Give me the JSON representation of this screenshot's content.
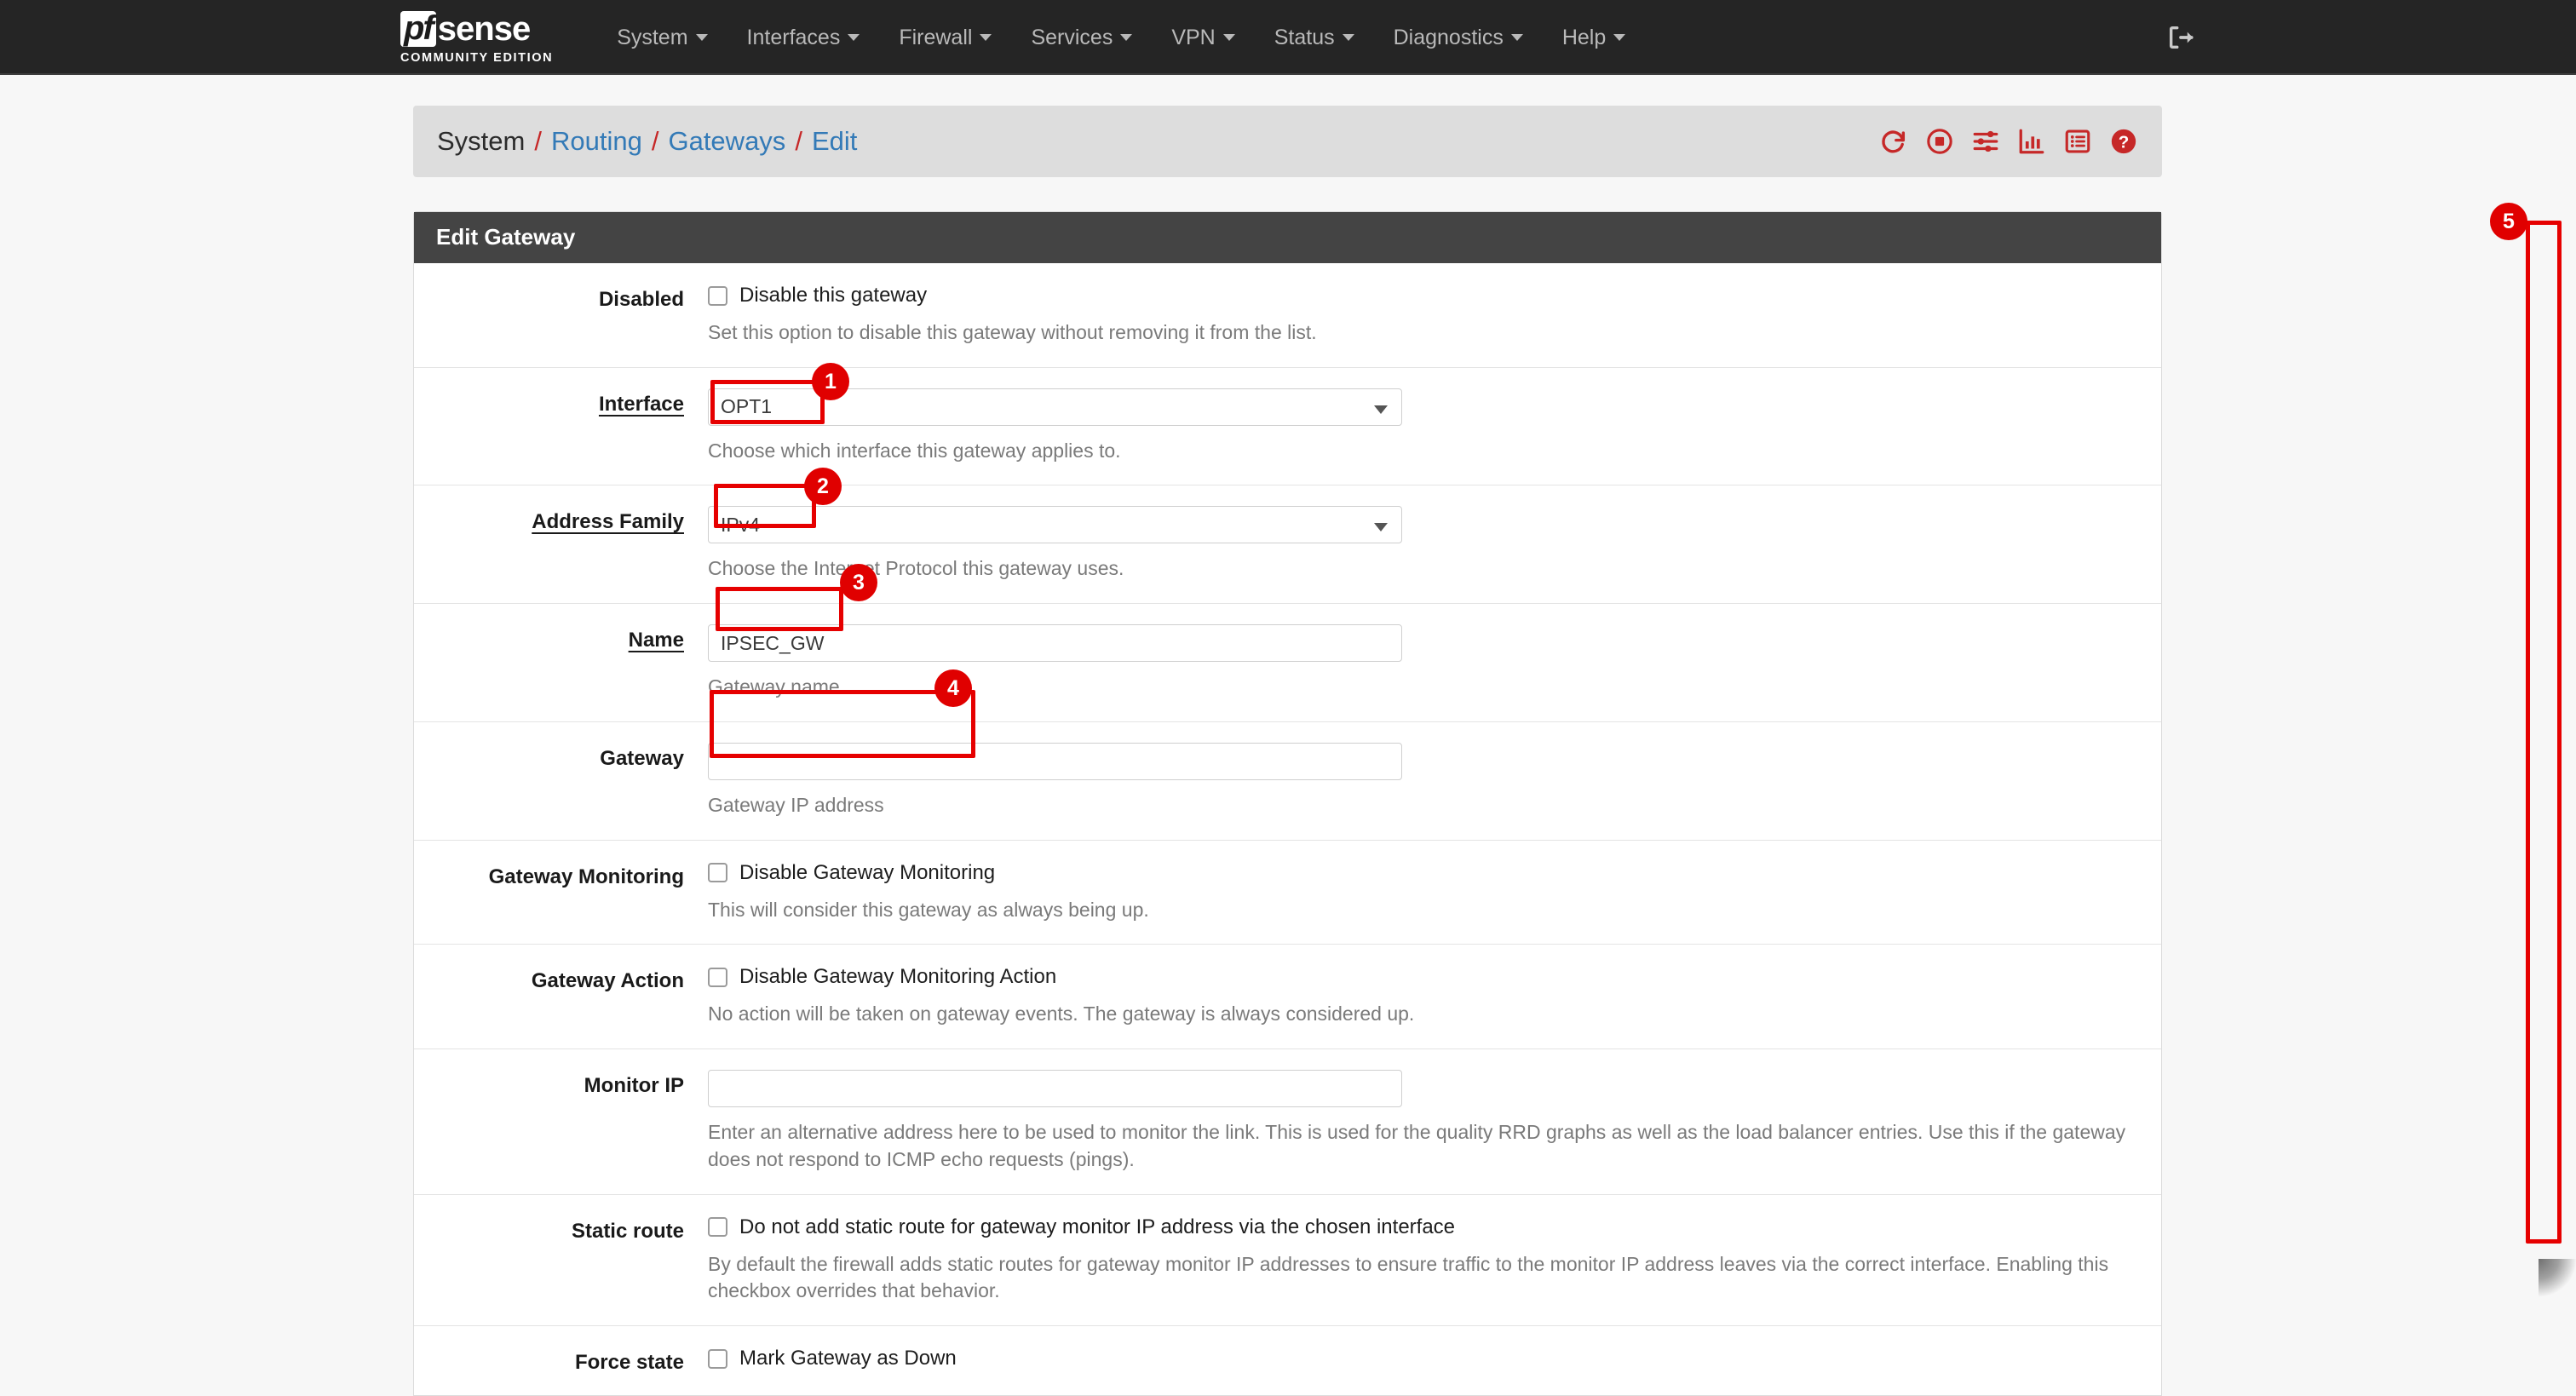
{
  "navbar": {
    "brand": {
      "mark": "pf",
      "word": "sense",
      "subtitle": "COMMUNITY EDITION"
    },
    "items": [
      {
        "label": "System",
        "icon": "chevron-down-icon"
      },
      {
        "label": "Interfaces",
        "icon": "chevron-down-icon"
      },
      {
        "label": "Firewall",
        "icon": "chevron-down-icon"
      },
      {
        "label": "Services",
        "icon": "chevron-down-icon"
      },
      {
        "label": "VPN",
        "icon": "chevron-down-icon"
      },
      {
        "label": "Status",
        "icon": "chevron-down-icon"
      },
      {
        "label": "Diagnostics",
        "icon": "chevron-down-icon"
      },
      {
        "label": "Help",
        "icon": "chevron-down-icon"
      }
    ],
    "logout_icon": "logout-icon"
  },
  "breadcrumb": {
    "root": "System",
    "sep": "/",
    "links": [
      "Routing",
      "Gateways",
      "Edit"
    ],
    "icons": [
      "restart-icon",
      "halt-icon",
      "sliders-icon",
      "bar-chart-icon",
      "list-icon",
      "help-circle-icon"
    ]
  },
  "panel": {
    "title": "Edit Gateway",
    "rows": [
      {
        "label": "Disabled",
        "tooltip": false,
        "type": "checkbox",
        "checkbox_label": "Disable this gateway",
        "help": "Set this option to disable this gateway without removing it from the list."
      },
      {
        "label": "Interface",
        "tooltip": true,
        "type": "select",
        "value": "OPT1",
        "help": "Choose which interface this gateway applies to."
      },
      {
        "label": "Address Family",
        "tooltip": true,
        "type": "select",
        "value": "IPv4",
        "help": "Choose the Internet Protocol this gateway uses."
      },
      {
        "label": "Name",
        "tooltip": true,
        "type": "input",
        "value": "IPSEC_GW",
        "placeholder": "",
        "help": "Gateway name"
      },
      {
        "label": "Gateway",
        "tooltip": false,
        "type": "input",
        "value": "",
        "placeholder": "",
        "help": "Gateway IP address"
      },
      {
        "label": "Gateway Monitoring",
        "tooltip": false,
        "type": "checkbox",
        "checkbox_label": "Disable Gateway Monitoring",
        "help": "This will consider this gateway as always being up."
      },
      {
        "label": "Gateway Action",
        "tooltip": false,
        "type": "checkbox",
        "checkbox_label": "Disable Gateway Monitoring Action",
        "help": "No action will be taken on gateway events. The gateway is always considered up."
      },
      {
        "label": "Monitor IP",
        "tooltip": false,
        "type": "input",
        "value": "",
        "placeholder": "",
        "help": "Enter an alternative address here to be used to monitor the link. This is used for the quality RRD graphs as well as the load balancer entries. Use this if the gateway does not respond to ICMP echo requests (pings)."
      },
      {
        "label": "Static route",
        "tooltip": false,
        "type": "checkbox",
        "checkbox_label": "Do not add static route for gateway monitor IP address via the chosen interface",
        "help": "By default the firewall adds static routes for gateway monitor IP addresses to ensure traffic to the monitor IP address leaves via the correct interface. Enabling this checkbox overrides that behavior."
      },
      {
        "label": "Force state",
        "tooltip": false,
        "type": "checkbox",
        "checkbox_label": "Mark Gateway as Down",
        "help": ""
      }
    ]
  },
  "annotations": [
    {
      "number": "1",
      "target": "interface-select-value"
    },
    {
      "number": "2",
      "target": "address-family-select-value"
    },
    {
      "number": "3",
      "target": "name-input-value"
    },
    {
      "number": "4",
      "target": "gateway-input"
    },
    {
      "number": "5",
      "target": "page-scrollbar"
    }
  ],
  "colors": {
    "accent_red": "#e00000",
    "link_blue": "#337ab7",
    "nav_dark": "#252525",
    "panel_head": "#444444",
    "icon_red": "#c62828"
  }
}
